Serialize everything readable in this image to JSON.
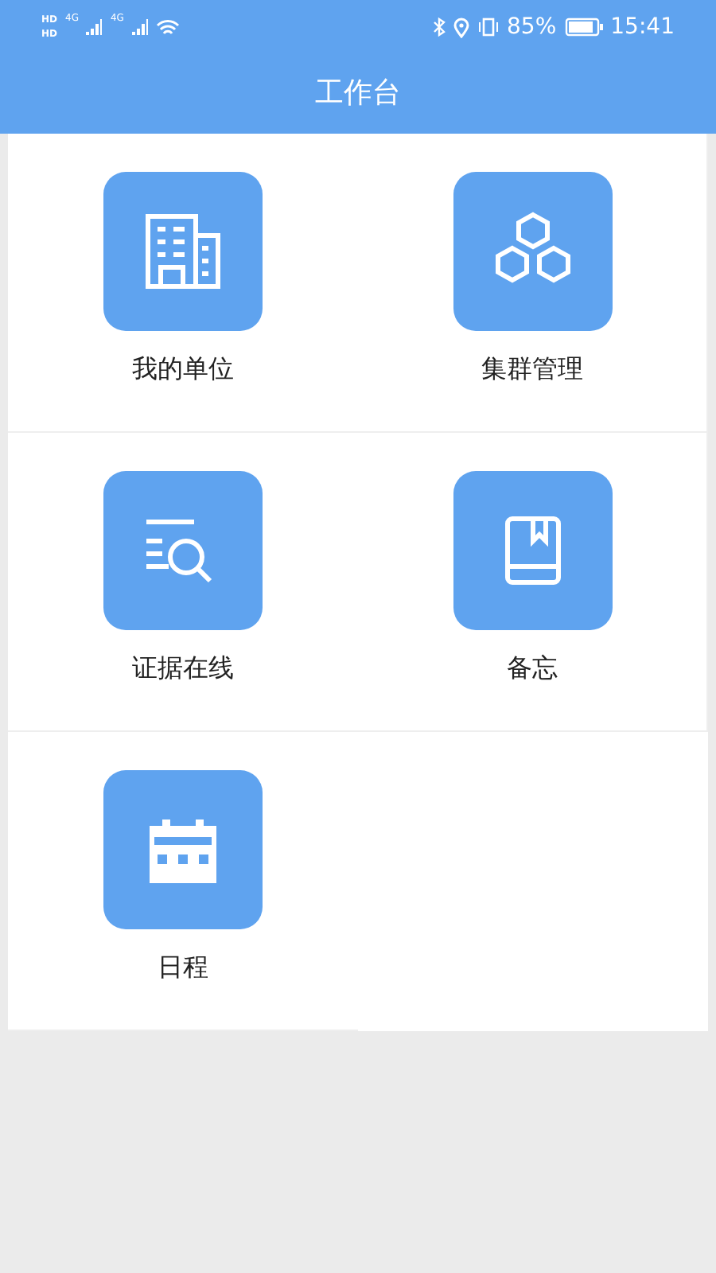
{
  "status_bar": {
    "left": [
      "HD",
      "HD",
      "4G",
      "4G"
    ],
    "battery": "85%",
    "time": "15:41"
  },
  "header": {
    "title": "工作台"
  },
  "apps": [
    {
      "label": "我的单位",
      "kind": "building"
    },
    {
      "label": "集群管理",
      "kind": "hexagons"
    },
    {
      "label": "证据在线",
      "kind": "search-list"
    },
    {
      "label": "备忘",
      "kind": "book"
    },
    {
      "label": "日程",
      "kind": "calendar"
    }
  ]
}
